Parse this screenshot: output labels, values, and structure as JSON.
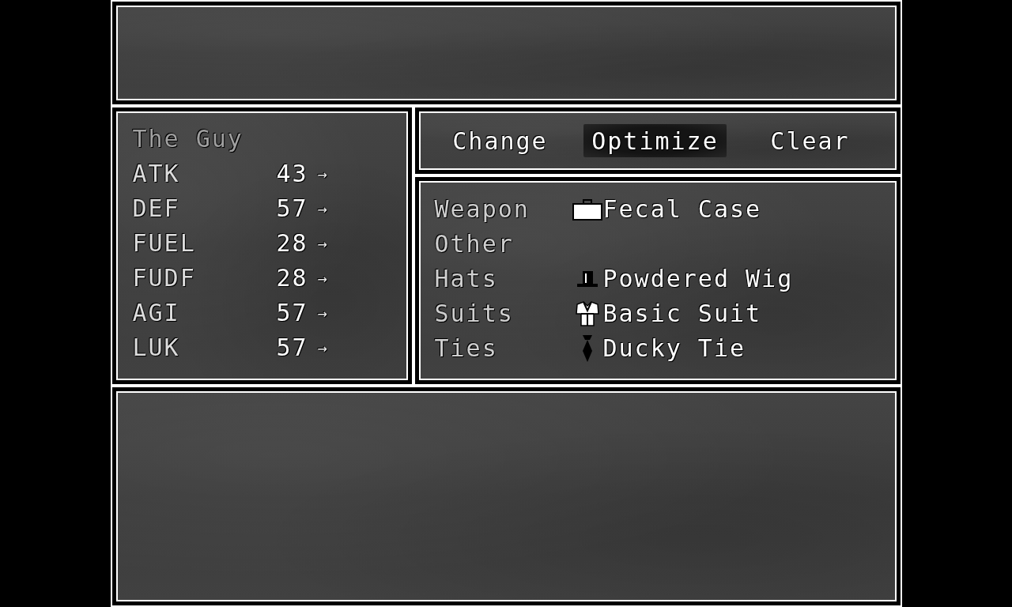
{
  "status": {
    "name": "The Guy",
    "stats": [
      {
        "label": "ATK",
        "value": "43",
        "arrow": "→"
      },
      {
        "label": "DEF",
        "value": "57",
        "arrow": "→"
      },
      {
        "label": "FUEL",
        "value": "28",
        "arrow": "→"
      },
      {
        "label": "FUDF",
        "value": "28",
        "arrow": "→"
      },
      {
        "label": "AGI",
        "value": "57",
        "arrow": "→"
      },
      {
        "label": "LUK",
        "value": "57",
        "arrow": "→"
      }
    ]
  },
  "commands": [
    {
      "label": "Change",
      "selected": false
    },
    {
      "label": "Optimize",
      "selected": true
    },
    {
      "label": "Clear",
      "selected": false
    }
  ],
  "equipment": [
    {
      "slot": "Weapon",
      "kind": "briefcase",
      "item": "Fecal Case"
    },
    {
      "slot": "Other"
    },
    {
      "slot": "Hats",
      "kind": "top-hat",
      "item": "Powdered Wig"
    },
    {
      "slot": "Suits",
      "kind": "suit",
      "item": "Basic Suit"
    },
    {
      "slot": "Ties",
      "kind": "tie",
      "item": "Ducky Tie"
    }
  ]
}
